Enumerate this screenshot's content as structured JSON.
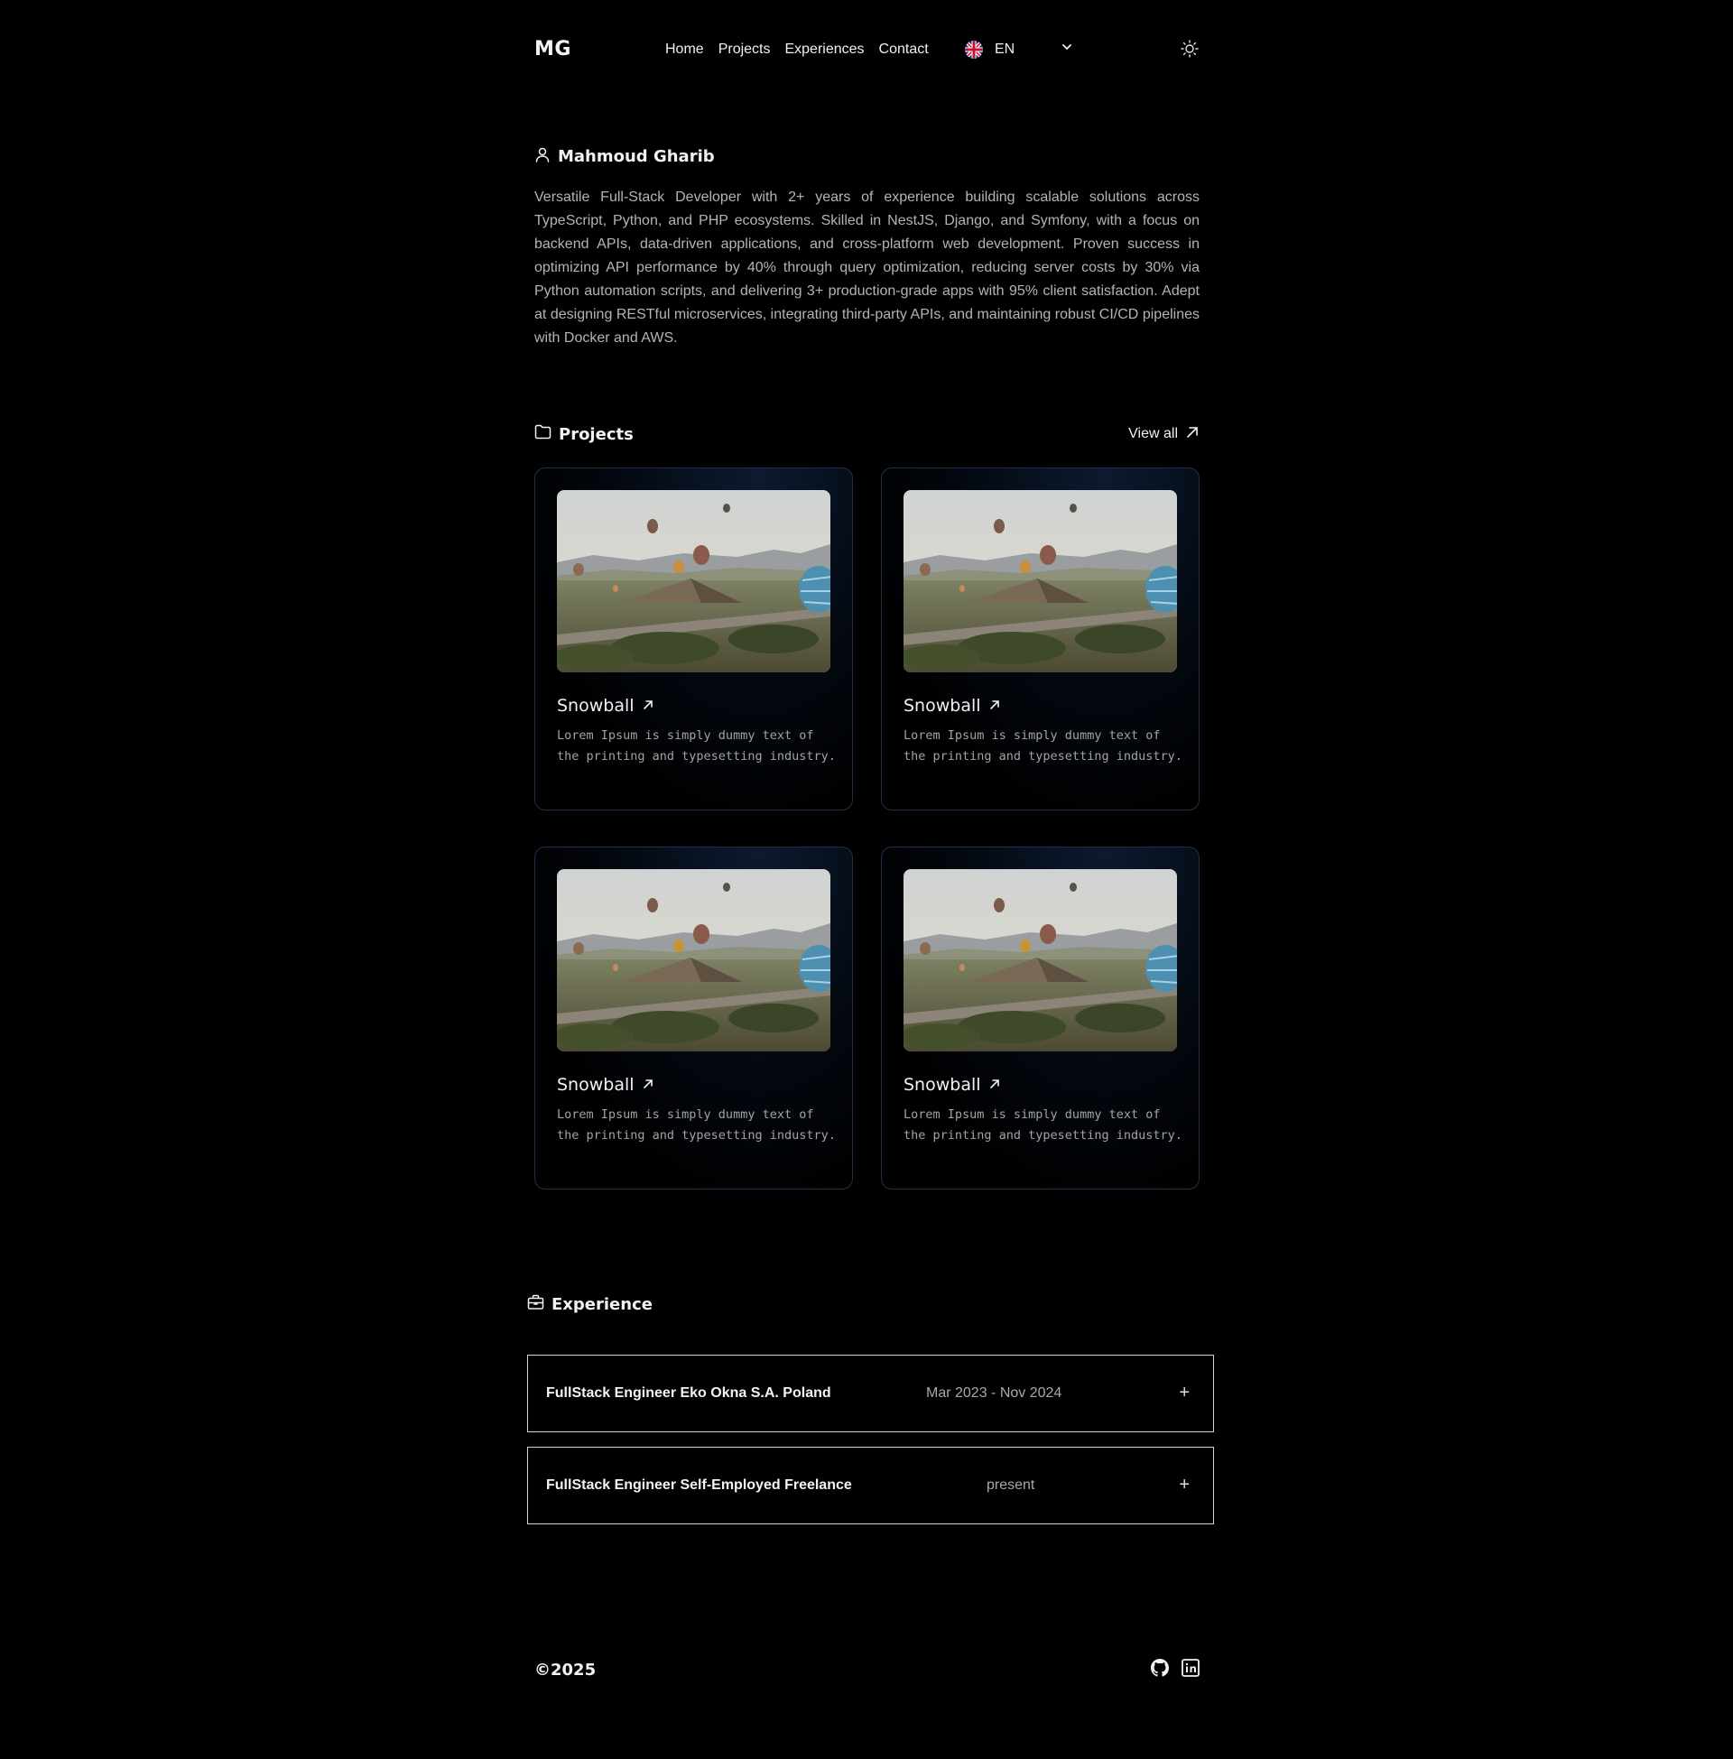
{
  "header": {
    "logo": "MG",
    "nav": [
      "Home",
      "Projects",
      "Experiences",
      "Contact"
    ],
    "language": "EN"
  },
  "about": {
    "name": "Mahmoud Gharib",
    "bio": "Versatile Full-Stack Developer with 2+ years of experience building scalable solutions across TypeScript, Python, and PHP ecosystems. Skilled in NestJS, Django, and Symfony, with a focus on backend APIs, data-driven applications, and cross-platform web development. Proven success in optimizing API performance by 40% through query optimization, reducing server costs by 30% via Python automation scripts, and delivering 3+ production-grade apps with 95% client satisfaction. Adept at designing RESTful microservices, integrating third-party APIs, and maintaining robust CI/CD pipelines with Docker and AWS."
  },
  "projects": {
    "title": "Projects",
    "view_all": "View all",
    "items": [
      {
        "title": "Snowball",
        "description": "Lorem Ipsum is simply dummy text of the printing and typesetting industry."
      },
      {
        "title": "Snowball",
        "description": "Lorem Ipsum is simply dummy text of the printing and typesetting industry."
      },
      {
        "title": "Snowball",
        "description": "Lorem Ipsum is simply dummy text of the printing and typesetting industry."
      },
      {
        "title": "Snowball",
        "description": "Lorem Ipsum is simply dummy text of the printing and typesetting industry."
      }
    ]
  },
  "experience": {
    "title": "Experience",
    "items": [
      {
        "role": "FullStack Engineer Eko Okna S.A. Poland",
        "period": "Mar 2023 - Nov 2024",
        "toggle": "+"
      },
      {
        "role": "FullStack Engineer Self-Employed Freelance",
        "period": "present",
        "toggle": "+"
      }
    ]
  },
  "footer": {
    "copyright": "©2025",
    "social_icons": [
      "github-icon",
      "linkedin-icon"
    ]
  },
  "colors": {
    "background": "#000000",
    "card_border": "#1f2f4a",
    "text_muted": "#b4b4b4"
  }
}
